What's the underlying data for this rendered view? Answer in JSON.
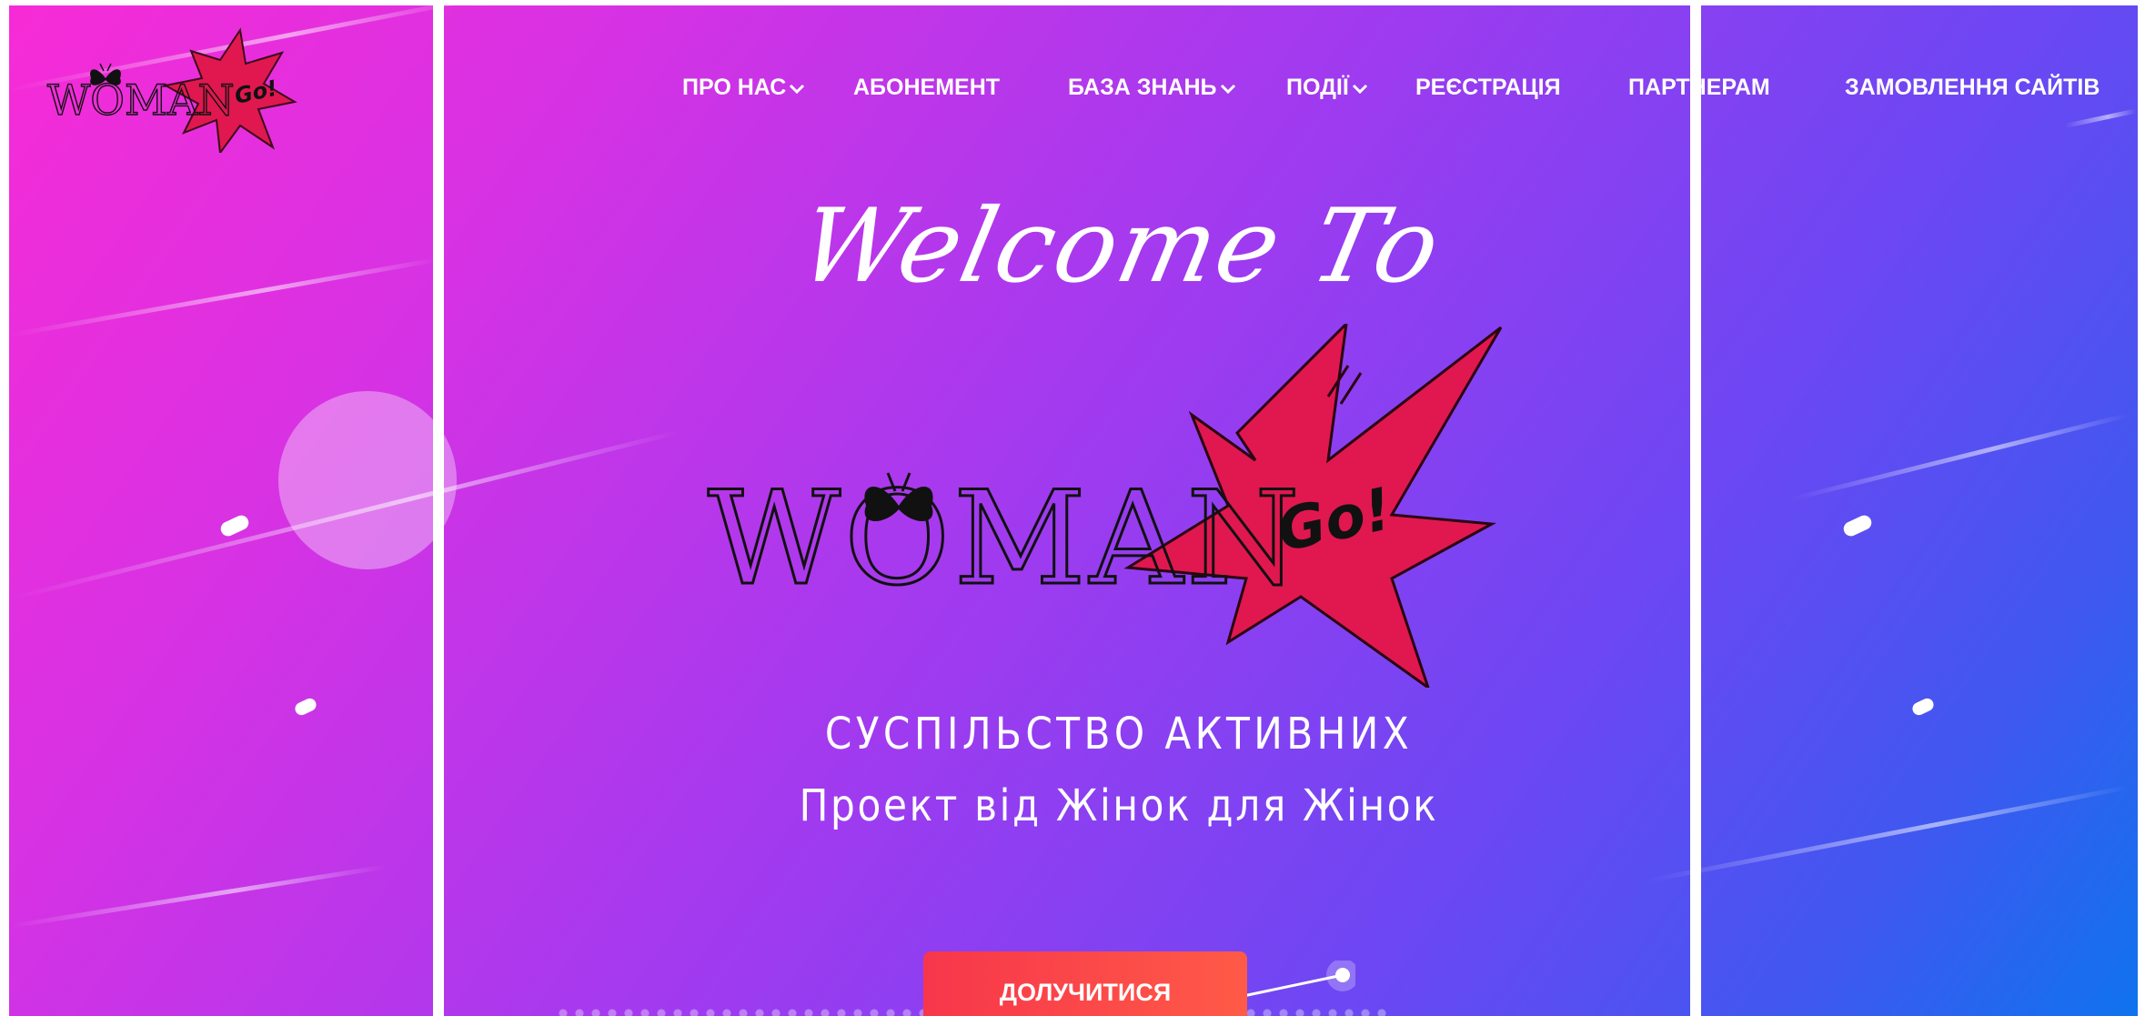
{
  "logo": {
    "word": "WOMAN",
    "badge": "Go!"
  },
  "nav": {
    "items": [
      {
        "label": "ПРО НАС",
        "dropdown": true
      },
      {
        "label": "АБОНЕМЕНТ",
        "dropdown": false
      },
      {
        "label": "БАЗА ЗНАНЬ",
        "dropdown": true
      },
      {
        "label": "ПОДІЇ",
        "dropdown": true
      },
      {
        "label": "РЕЄСТРАЦІЯ",
        "dropdown": false
      },
      {
        "label": "ПАРТНЕРАМ",
        "dropdown": false
      },
      {
        "label": "ЗАМОВЛЕННЯ САЙТІВ",
        "dropdown": false
      }
    ]
  },
  "hero": {
    "welcome": "Welcome To",
    "tagline_line1": "СУСПІЛЬСТВО АКТИВНИХ",
    "tagline_line2": "Проект від Жінок для Жінок",
    "cta_label": "ДОЛУЧИТИСЯ"
  },
  "colors": {
    "gradient_start": "#f72bd6",
    "gradient_mid": "#9d3bf0",
    "gradient_end": "#0f73ee",
    "star_fill": "#e0184f",
    "cta": "#f7364b"
  },
  "icons": [
    "butterfly-icon",
    "starburst-icon",
    "chevron-down-icon"
  ]
}
